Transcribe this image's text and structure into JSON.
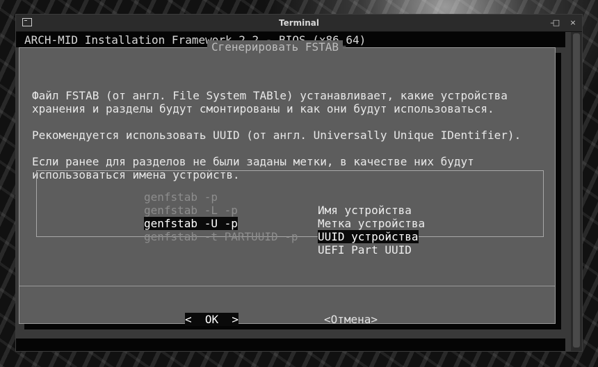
{
  "window": {
    "title": "Terminal",
    "minimize_label": "–",
    "maximize_label": "□",
    "close_label": "×"
  },
  "terminal": {
    "header": "ARCH-MID Installation Framework 2.2 - BIOS (x86_64)"
  },
  "dialog": {
    "title": "Сгенерировать FSTAB",
    "paragraphs": [
      "Файл FSTAB (от англ. File System TABle) устанавливает, какие устройства",
      "хранения и разделы будут смонтированы и как они будут использоваться.",
      "Рекомендуется использовать UUID (от англ. Universally Unique IDentifier).",
      "Если ранее для разделов не были заданы метки, в качестве них будут",
      "использоваться имена устройств."
    ],
    "menu": [
      {
        "tag": "genfstab -p",
        "desc": "Имя устройства",
        "selected": false
      },
      {
        "tag": "genfstab -L -p",
        "desc": "Метка устройства",
        "selected": false
      },
      {
        "tag": "genfstab -U -p",
        "desc": "UUID устройства",
        "selected": true
      },
      {
        "tag": "genfstab -t PARTUUID -p",
        "desc": "UEFI Part UUID",
        "selected": false
      }
    ],
    "ok_label": "<  OK  >",
    "cancel_label": "<Отмена>"
  },
  "colors": {
    "dialog_bg": "#5d5d5d",
    "selection_bg": "#0a0a0a",
    "inactive_tag": "#8d8d8d"
  }
}
